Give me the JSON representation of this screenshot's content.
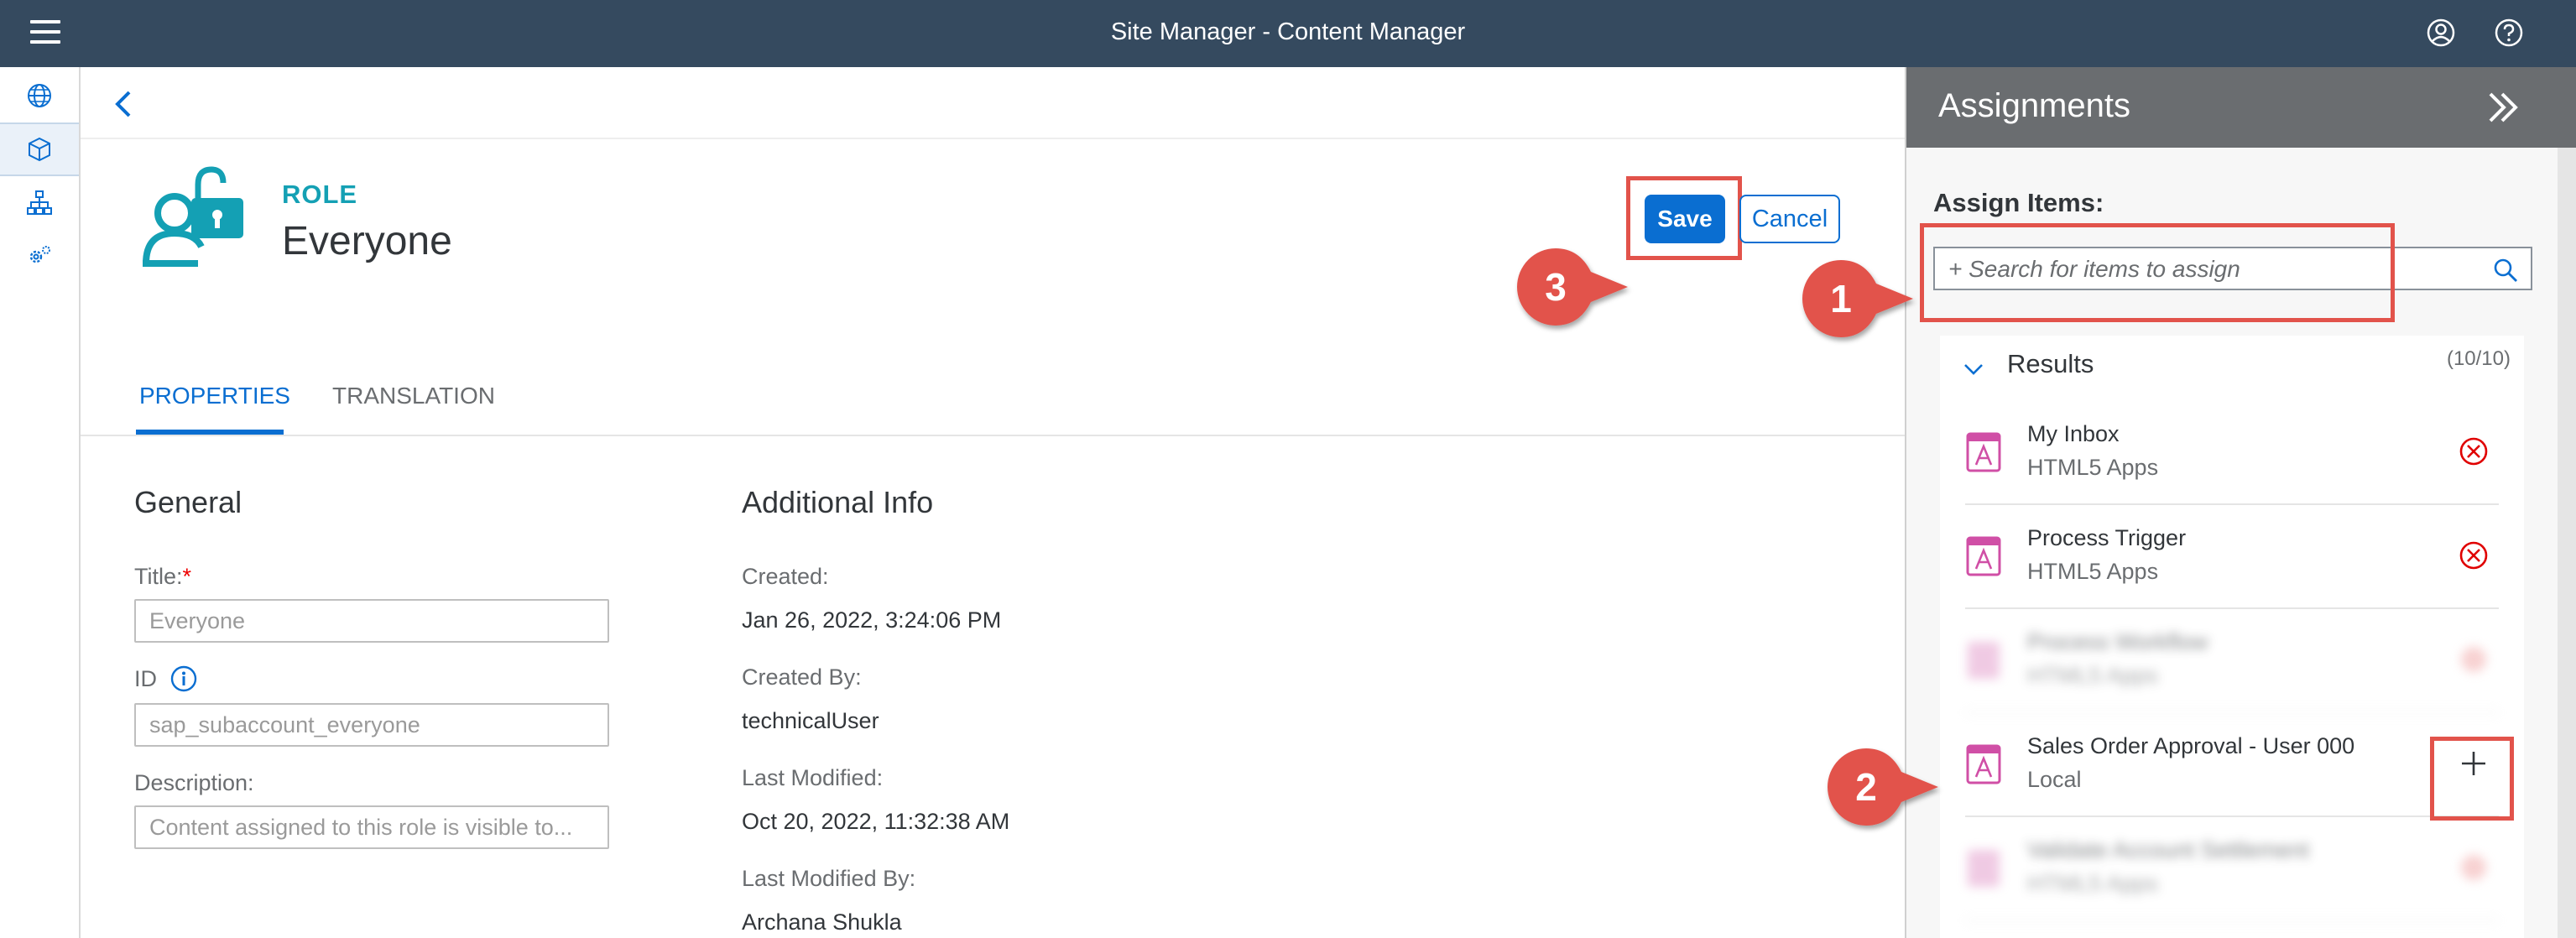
{
  "shell": {
    "title": "Site Manager - Content Manager"
  },
  "header": {
    "role_label": "ROLE",
    "role_name": "Everyone"
  },
  "actions": {
    "save_label": "Save",
    "cancel_label": "Cancel"
  },
  "tabs": [
    {
      "label": "PROPERTIES",
      "selected": true
    },
    {
      "label": "TRANSLATION",
      "selected": false
    }
  ],
  "general": {
    "title": "General",
    "title_label": "Title:",
    "required_mark": "*",
    "title_value": "Everyone",
    "id_label": "ID",
    "id_value": "sap_subaccount_everyone",
    "description_label": "Description:",
    "description_value": "Content assigned to this role is visible to..."
  },
  "additional": {
    "title": "Additional Info",
    "created_label": "Created:",
    "created_value": "Jan 26, 2022, 3:24:06 PM",
    "created_by_label": "Created By:",
    "created_by_value": "technicalUser",
    "modified_label": "Last Modified:",
    "modified_value": "Oct 20, 2022, 11:32:38 AM",
    "modified_by_label": "Last Modified By:",
    "modified_by_value": "Archana Shukla"
  },
  "assignments": {
    "title": "Assignments",
    "assign_items_label": "Assign Items:",
    "search_placeholder": "+ Search for items to assign",
    "results_title": "Results",
    "results_count": "(10/10)",
    "items": [
      {
        "title": "My Inbox",
        "subtitle": "HTML5 Apps",
        "action": "remove"
      },
      {
        "title": "Process Trigger",
        "subtitle": "HTML5 Apps",
        "action": "remove"
      },
      {
        "title": "Process Workflow",
        "subtitle": "HTML5 Apps",
        "action": "remove"
      },
      {
        "title": "Sales Order Approval - User 000",
        "subtitle": "Local",
        "action": "add"
      },
      {
        "title": "Validate Account Settlement",
        "subtitle": "HTML5 Apps",
        "action": "remove"
      }
    ]
  },
  "callouts": [
    "1",
    "2",
    "3"
  ],
  "colors": {
    "shell": "#354a5f",
    "accent": "#0a6ed1",
    "teal": "#14a0b4",
    "callout": "#e2534b",
    "remove": "#e00000",
    "app_icon": "#d04fa6"
  },
  "icons": {
    "menu": "hamburger-icon",
    "user": "user-icon",
    "help": "help-icon",
    "back": "back-icon",
    "search": "search-icon"
  }
}
